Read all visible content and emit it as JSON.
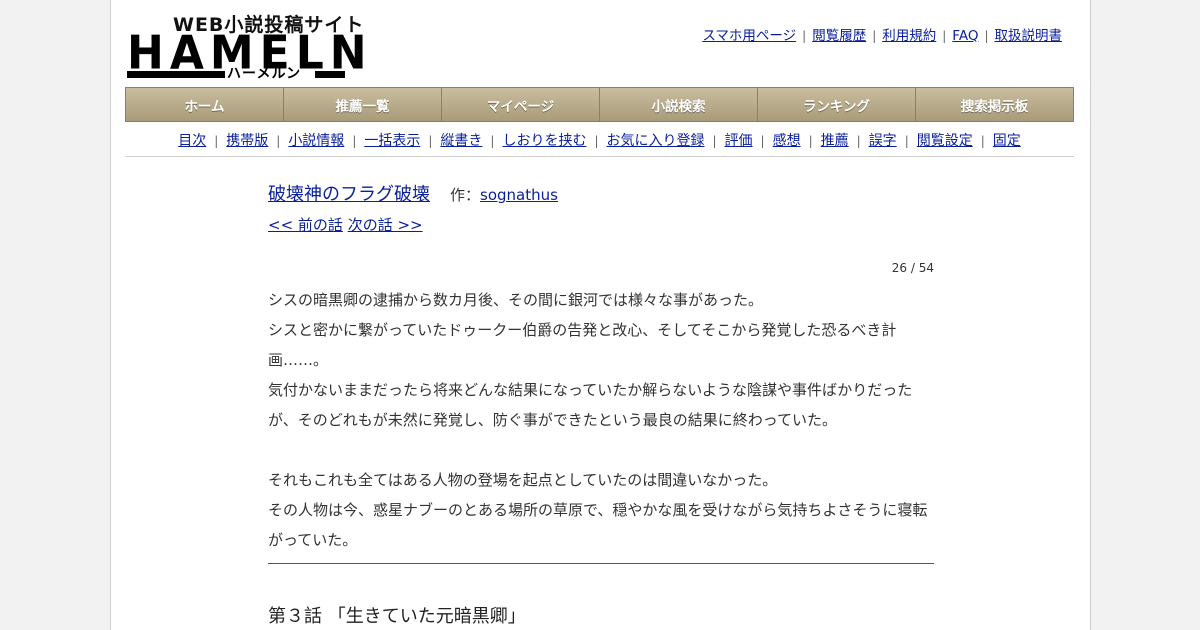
{
  "logo": {
    "tagline": "WEB小説投稿サイト",
    "wordmark": "HAMELN",
    "kana": "ハーメルン"
  },
  "top_links": [
    "スマホ用ページ",
    "閲覧履歴",
    "利用規約",
    "FAQ",
    "取扱説明書"
  ],
  "main_nav": [
    "ホーム",
    "推薦一覧",
    "マイページ",
    "小説検索",
    "ランキング",
    "捜索掲示板"
  ],
  "sub_nav": [
    "目次",
    "携帯版",
    "小説情報",
    "一括表示",
    "縦書き",
    "しおりを挟む",
    "お気に入り登録",
    "評価",
    "感想",
    "推薦",
    "誤字",
    "閲覧設定",
    "固定"
  ],
  "novel": {
    "title": "破壊神のフラグ破壊",
    "author_label": "作：",
    "author": "sognathus",
    "prev": "<< 前の話",
    "next": "次の話 >>",
    "counter": "26 / 54",
    "paragraphs": [
      "シスの暗黒卿の逮捕から数カ月後、その間に銀河では様々な事があった。",
      "シスと密かに繋がっていたドゥークー伯爵の告発と改心、そしてそこから発覚した恐るべき計画……。",
      "気付かないままだったら将来どんな結果になっていたか解らないような陰謀や事件ばかりだったが、そのどれもが未然に発覚し、防ぐ事ができたという最良の結果に終わっていた。",
      "",
      "それもこれも全てはある人物の登場を起点としていたのは間違いなかった。",
      "その人物は今、惑星ナブーのとある場所の草原で、穏やかな風を受けながら気持ちよさそうに寝転がっていた。"
    ],
    "chapter_title": "第３話 「生きていた元暗黒卿」"
  }
}
